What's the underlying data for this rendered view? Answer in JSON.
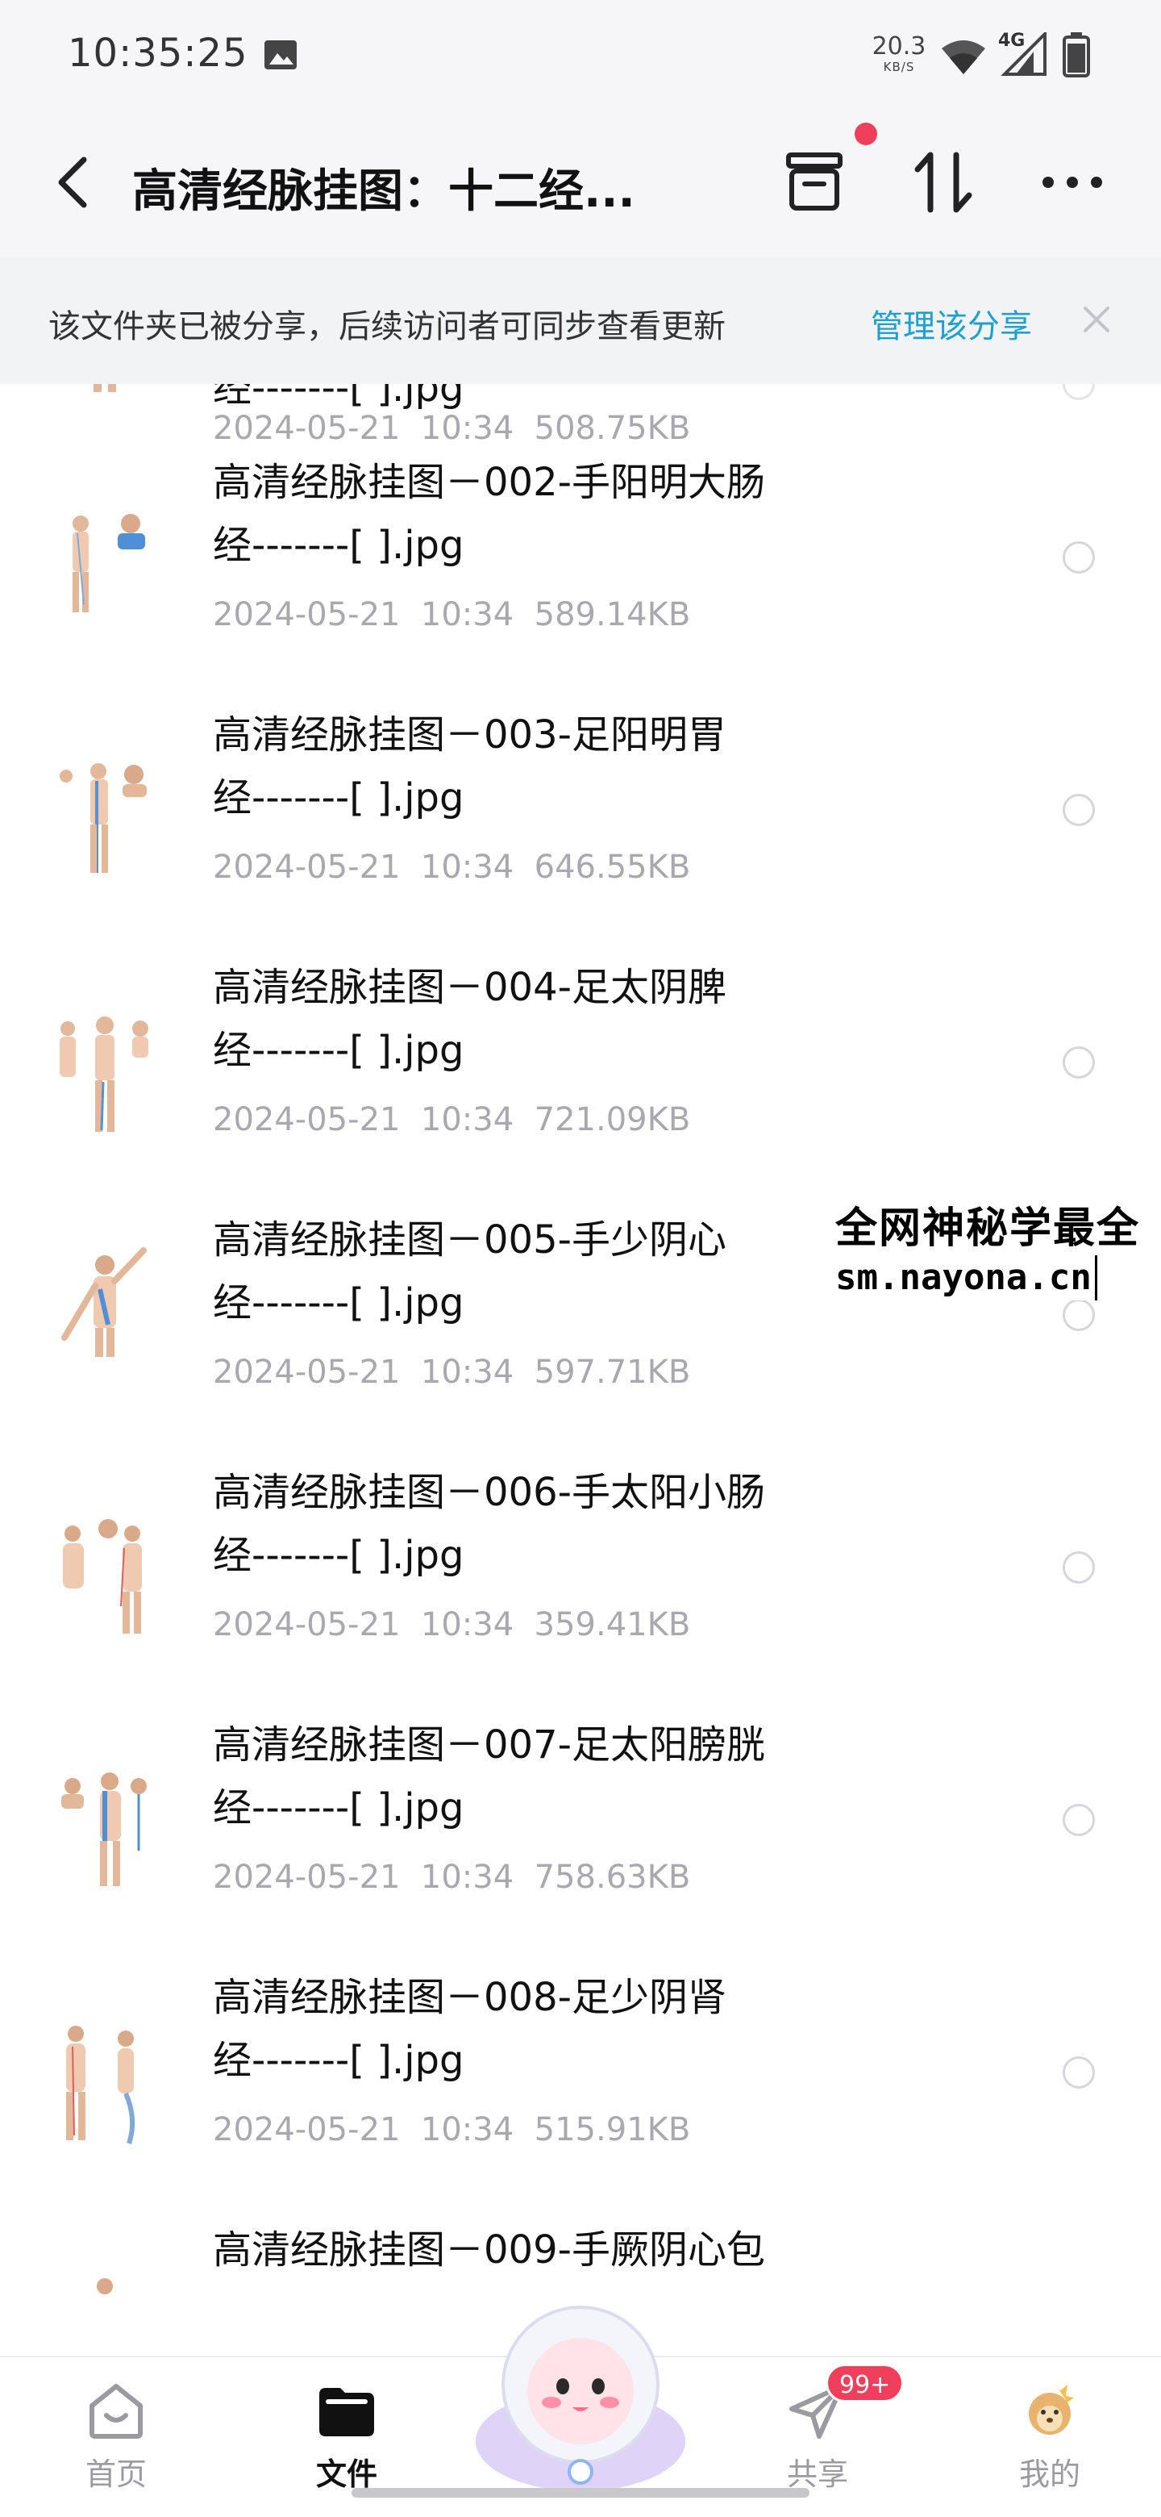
{
  "status_bar": {
    "time": "10:35:25",
    "speed_value": "20.3",
    "speed_unit": "KB/S",
    "network": "4G",
    "icons": [
      "image-icon",
      "wifi-icon",
      "signal-icon",
      "battery-icon"
    ]
  },
  "header": {
    "title": "高清经脉挂图：十二经...",
    "icons": [
      "back-icon",
      "box-icon",
      "sort-icon",
      "more-icon"
    ]
  },
  "notice": {
    "text": "该文件夹已被分享，后续访问者可同步查看更新",
    "link": "管理该分享"
  },
  "files": [
    {
      "name_line1": "经-------[ ].jpg",
      "name_line2": "",
      "date": "2024-05-21",
      "time": "10:34",
      "size": "508.75KB"
    },
    {
      "name_line1": "高清经脉挂图－002-手阳明大肠",
      "name_line2": "经-------[ ].jpg",
      "date": "2024-05-21",
      "time": "10:34",
      "size": "589.14KB"
    },
    {
      "name_line1": "高清经脉挂图－003-足阳明胃",
      "name_line2": "经-------[ ].jpg",
      "date": "2024-05-21",
      "time": "10:34",
      "size": "646.55KB"
    },
    {
      "name_line1": "高清经脉挂图－004-足太阴脾",
      "name_line2": "经-------[ ].jpg",
      "date": "2024-05-21",
      "time": "10:34",
      "size": "721.09KB"
    },
    {
      "name_line1": "高清经脉挂图－005-手少阴心",
      "name_line2": "经-------[ ].jpg",
      "date": "2024-05-21",
      "time": "10:34",
      "size": "597.71KB"
    },
    {
      "name_line1": "高清经脉挂图－006-手太阳小肠",
      "name_line2": "经-------[ ].jpg",
      "date": "2024-05-21",
      "time": "10:34",
      "size": "359.41KB"
    },
    {
      "name_line1": "高清经脉挂图－007-足太阳膀胱",
      "name_line2": "经-------[ ].jpg",
      "date": "2024-05-21",
      "time": "10:34",
      "size": "758.63KB"
    },
    {
      "name_line1": "高清经脉挂图－008-足少阴肾",
      "name_line2": "经-------[ ].jpg",
      "date": "2024-05-21",
      "time": "10:34",
      "size": "515.91KB"
    },
    {
      "name_line1": "高清经脉挂图－009-手厥阴心包",
      "name_line2": "",
      "date": "",
      "time": "",
      "size": ""
    }
  ],
  "watermark": {
    "line1": "全网神秘学最全",
    "line2": "sm.nayona.cn"
  },
  "bottom_nav": {
    "items": [
      {
        "label": "首页",
        "icon": "home-icon",
        "active": false
      },
      {
        "label": "文件",
        "icon": "folder-icon",
        "active": true
      },
      {
        "label": "共享",
        "icon": "paper-plane-icon",
        "active": false,
        "badge": "99+"
      },
      {
        "label": "我的",
        "icon": "avatar-icon",
        "active": false
      }
    ]
  },
  "colors": {
    "accent_link": "#1fa0cf",
    "badge": "#ef3f5c",
    "meta_text": "#a8a8ae",
    "header_bg": "#f6f6f8"
  }
}
